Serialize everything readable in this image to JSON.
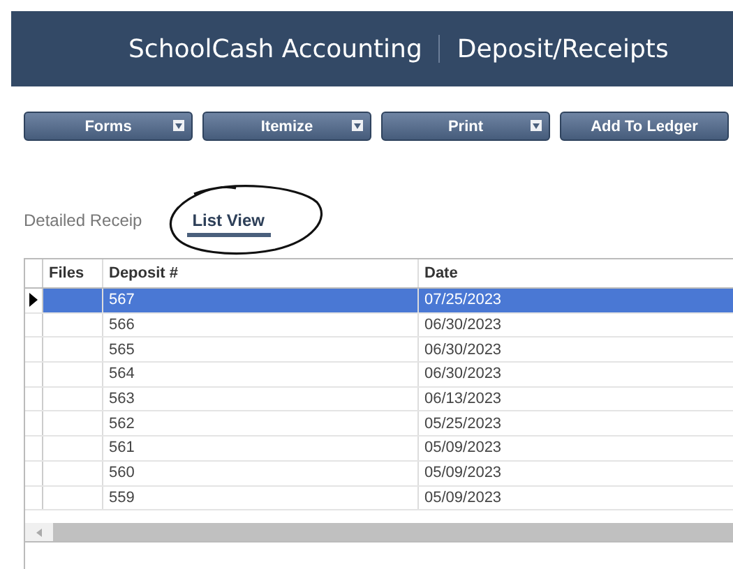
{
  "header": {
    "app_title": "SchoolCash Accounting",
    "page_title": "Deposit/Receipts"
  },
  "toolbar": [
    {
      "label": "Forms",
      "dropdown": true
    },
    {
      "label": "Itemize",
      "dropdown": true
    },
    {
      "label": "Print",
      "dropdown": true
    },
    {
      "label": "Add To Ledger",
      "dropdown": false
    }
  ],
  "tabs": [
    {
      "label": "Detailed Receip",
      "selected": false
    },
    {
      "label": "List View",
      "selected": true
    }
  ],
  "table": {
    "columns": [
      "Files",
      "Deposit #",
      "Date"
    ],
    "rows": [
      {
        "files": "",
        "deposit": "567",
        "date": "07/25/2023",
        "selected": true
      },
      {
        "files": "",
        "deposit": "566",
        "date": "06/30/2023",
        "selected": false
      },
      {
        "files": "",
        "deposit": "565",
        "date": "06/30/2023",
        "selected": false
      },
      {
        "files": "",
        "deposit": "564",
        "date": "06/30/2023",
        "selected": false
      },
      {
        "files": "",
        "deposit": "563",
        "date": "06/13/2023",
        "selected": false
      },
      {
        "files": "",
        "deposit": "562",
        "date": "05/25/2023",
        "selected": false
      },
      {
        "files": "",
        "deposit": "561",
        "date": "05/09/2023",
        "selected": false
      },
      {
        "files": "",
        "deposit": "560",
        "date": "05/09/2023",
        "selected": false
      },
      {
        "files": "",
        "deposit": "559",
        "date": "05/09/2023",
        "selected": false
      }
    ]
  }
}
